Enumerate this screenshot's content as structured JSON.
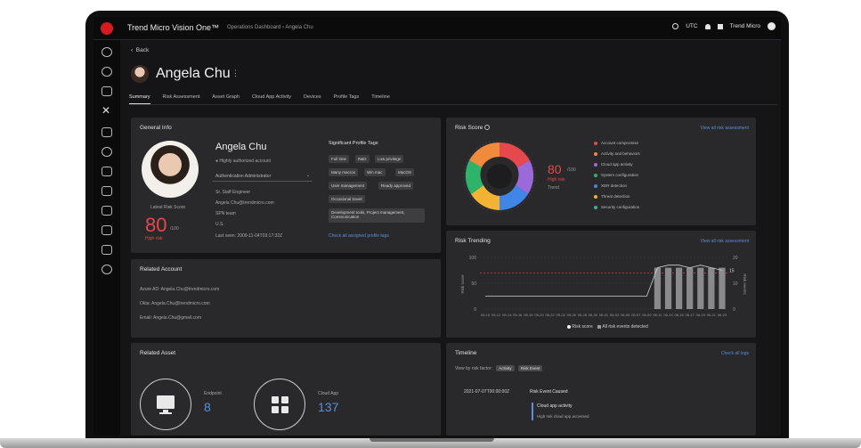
{
  "topbar": {
    "brand": "Trend Micro Vision One™",
    "breadcrumb": "Operations Dashboard  ›  Angela Chu",
    "status": "UTC",
    "org": "Trend Micro"
  },
  "page": {
    "back_label": "Back",
    "title": "Angela Chu",
    "more": "⋮"
  },
  "tabs": [
    "Summary",
    "Risk Assessment",
    "Asset Graph",
    "Cloud App Activity",
    "Devices",
    "Profile Tags",
    "Timeline"
  ],
  "general_info": {
    "title": "General Info",
    "name": "Angela Chu",
    "flag": "Highly authorized account",
    "role_select": "Authentication Administrator",
    "job_title": "Sr. Staff Engineer",
    "email": "Angela Chu@trendmicro.com",
    "department": "SPN team",
    "location": "U.S.",
    "last_seen": "Last seen: 2009-11-04T03:17:32Z",
    "latest_risk_label": "Latest Risk Score",
    "latest_risk_value": "80",
    "latest_risk_suffix": "/100",
    "risk_level": "High risk",
    "tags_title": "Significant Profile Tags",
    "tags": [
      "Full time",
      "R&D",
      "Low privilege",
      "Many macros",
      "Win mac",
      "MacOS",
      "User management",
      "Ready approved",
      "Occasional travel",
      "Development tools, Project management, Communication"
    ],
    "tags_link": "Check all assigned profile tags"
  },
  "related_account": {
    "title": "Related Account",
    "lines": [
      "Azure AD: Angela.Chu@trendmicro.com",
      "Okta: Angela.Chu@trendmicro.com",
      "Email: Angela.Chu@gmail.com"
    ]
  },
  "related_asset": {
    "title": "Related Asset",
    "endpoint_label": "Endpoint",
    "endpoint_value": "8",
    "cloud_label": "Cloud App",
    "cloud_value": "137"
  },
  "risk_score": {
    "title": "Risk Score",
    "link": "View all risk assessment",
    "score": "80",
    "score_suffix": "/100",
    "level": "High risk",
    "trend": "Trend",
    "legend": [
      {
        "label": "Account compromise",
        "color": "#e5484d"
      },
      {
        "label": "Activity and behaviors",
        "color": "#f08a3c"
      },
      {
        "label": "Cloud app activity",
        "color": "#9b6ad8"
      },
      {
        "label": "System configuration",
        "color": "#2fb36b"
      },
      {
        "label": "XDR detection",
        "color": "#3f86e6"
      },
      {
        "label": "Threat detection",
        "color": "#f2b233"
      },
      {
        "label": "Security configuration",
        "color": "#2fb3a0"
      }
    ]
  },
  "risk_trending": {
    "title": "Risk Trending",
    "link": "View all risk assessment",
    "legend_score": "Risk score",
    "legend_events": "All risk events detected"
  },
  "timeline": {
    "title": "Timeline",
    "link": "Check all logs",
    "filter_label": "View by risk factor:",
    "chips": [
      "Activity",
      "Risk Event"
    ],
    "date": "2021-07-07T00:00:00Z",
    "event": "Risk Event Caused",
    "sub_title": "Cloud app activity",
    "sub_desc": "High risk cloud app accessed"
  },
  "chart_data": {
    "type": "bar",
    "title": "Risk Trending",
    "categories": [
      "05-10",
      "05-12",
      "05-14",
      "05-16",
      "05-18",
      "05-20",
      "05-22",
      "05-24",
      "05-26",
      "05-28",
      "05-30",
      "06-01",
      "06-03",
      "06-05",
      "06-07",
      "06-09",
      "06-11",
      "06-13",
      "06-15",
      "06-17",
      "06-19",
      "06-21",
      "06-23"
    ],
    "series": [
      {
        "name": "Risk score",
        "values": [
          0,
          0,
          0,
          0,
          0,
          0,
          0,
          0,
          0,
          0,
          0,
          0,
          0,
          0,
          0,
          0,
          80,
          80,
          80,
          80,
          80,
          80,
          80
        ]
      }
    ],
    "line_series": [
      {
        "name": "All risk events detected",
        "values": [
          5,
          5,
          5,
          5,
          5,
          5,
          5,
          5,
          5,
          5,
          5,
          5,
          5,
          5,
          5,
          5,
          16,
          17,
          17,
          16,
          17,
          16,
          15
        ]
      }
    ],
    "ylabel": "Risk score",
    "ylim": [
      0,
      100
    ],
    "y2label": "Risk events",
    "y2lim": [
      0,
      20
    ],
    "y_ticks": [
      0,
      50,
      100
    ],
    "y2_ticks": [
      0,
      10,
      20
    ],
    "right_annotation": "15"
  }
}
